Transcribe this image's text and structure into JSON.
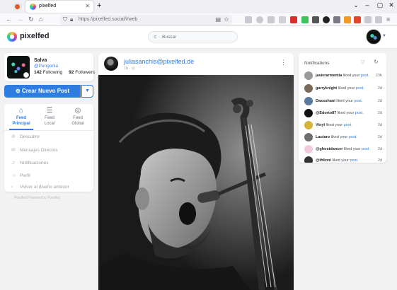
{
  "browser": {
    "tab_title": "pixelfed",
    "url_host": "https://pixelfed.social",
    "url_path": "/i/web",
    "url_full": "https://pixelfed.social/i/web"
  },
  "header": {
    "brand": "pixelfed",
    "search_placeholder": "Buscar"
  },
  "profile": {
    "name": "Salva",
    "handle": "@Pengonia",
    "following_count": "142",
    "following_label": "Following",
    "followers_count": "92",
    "followers_label": "Followers"
  },
  "create_post": {
    "label": "Crear Nuevo Post"
  },
  "feeds": [
    {
      "line1": "Feed",
      "line2": "Principal",
      "icon": "home-icon",
      "active": true
    },
    {
      "line1": "Feed",
      "line2": "Local",
      "icon": "list-icon",
      "active": false
    },
    {
      "line1": "Feed",
      "line2": "Global",
      "icon": "globe-icon",
      "active": false
    }
  ],
  "menu": [
    {
      "label": "Descubre",
      "icon": "compass-icon"
    },
    {
      "label": "Mensajes Directos",
      "icon": "envelope-icon"
    },
    {
      "label": "Notificaciones",
      "icon": "bell-icon"
    },
    {
      "label": "Perfil",
      "icon": "user-icon"
    },
    {
      "label": "Volver al diseño anterior",
      "icon": "chevron-left-icon"
    }
  ],
  "footer_note": "Pixelfed  Powered by Pixelfed",
  "post": {
    "username": "juliasanchis@pixelfed.de",
    "meta": "1h · ◎"
  },
  "notifications": {
    "title": "Notifications",
    "items": [
      {
        "user": "javierarmentia",
        "action": "liked your",
        "object": "post.",
        "time": "23h"
      },
      {
        "user": "garryknight",
        "action": "liked your",
        "object": "post.",
        "time": "2d"
      },
      {
        "user": "Dassuhani",
        "action": "liked your",
        "object": "post.",
        "time": "2d"
      },
      {
        "user": "@Edorto87",
        "action": "liked your",
        "object": "post.",
        "time": "2d"
      },
      {
        "user": "Vinyl",
        "action": "liked your",
        "object": "post.",
        "time": "2d"
      },
      {
        "user": "Lautaro",
        "action": "liked your",
        "object": "post.",
        "time": "2d"
      },
      {
        "user": "@ghostdancer",
        "action": "liked your",
        "object": "post.",
        "time": "2d"
      },
      {
        "user": "@thlinni",
        "action": "liked your",
        "object": "post.",
        "time": "2d"
      }
    ]
  },
  "colors": {
    "accent": "#2f7de1",
    "link": "#3b82f6"
  }
}
